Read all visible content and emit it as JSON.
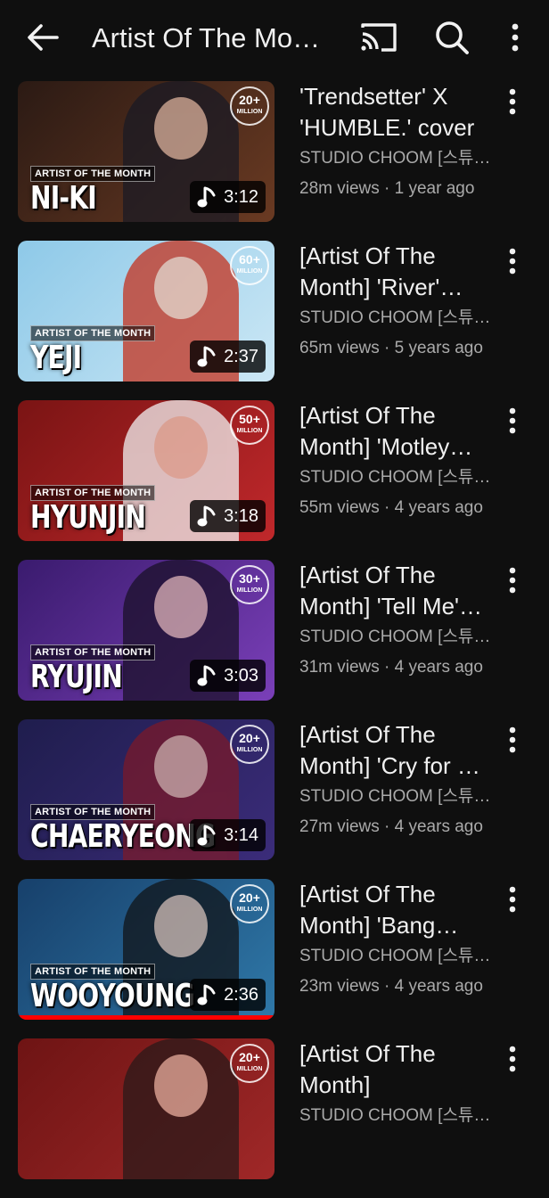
{
  "header": {
    "title": "Artist Of The Month",
    "icons": [
      "back-arrow-icon",
      "cast-icon",
      "search-icon",
      "more-vertical-icon"
    ]
  },
  "videos": [
    {
      "title": "'Trendsetter' X 'HUMBLE.' cover",
      "channel": "STUDIO CHOOM [스튜디오 춤]",
      "stats": "28m views · 1 year ago",
      "duration": "3:12",
      "thumb_artist": "NI-KI",
      "thumb_badge": "ARTIST OF THE MONTH",
      "award_num": "20+",
      "award_unit": "MILLION",
      "colors": {
        "bg1": "#2b1a14",
        "bg2": "#6a3a22",
        "figure": "#1a1a24"
      },
      "watched": 0
    },
    {
      "title": "[Artist Of The Month] 'River' cover",
      "channel": "STUDIO CHOOM [스튜디오 춤]",
      "stats": "65m views · 5 years ago",
      "duration": "2:37",
      "thumb_artist": "YEJI",
      "thumb_badge": "ARTIST OF THE MONTH",
      "award_num": "60+",
      "award_unit": "MILLION",
      "colors": {
        "bg1": "#8ec9e8",
        "bg2": "#cbe7f5",
        "figure": "#c4321e"
      },
      "watched": 0
    },
    {
      "title": "[Artist Of The Month] 'Motley Crew' cover",
      "channel": "STUDIO CHOOM [스튜디오 춤]",
      "stats": "55m views · 4 years ago",
      "duration": "3:18",
      "thumb_artist": "HYUNJIN",
      "thumb_badge": "ARTIST OF THE MONTH",
      "award_num": "50+",
      "award_unit": "MILLION",
      "colors": {
        "bg1": "#7a1414",
        "bg2": "#c0282b",
        "figure": "#f1f1f1"
      },
      "watched": 0
    },
    {
      "title": "[Artist Of The Month] 'Tell Me' cover",
      "channel": "STUDIO CHOOM [스튜디오 춤]",
      "stats": "31m views · 4 years ago",
      "duration": "3:03",
      "thumb_artist": "RYUJIN",
      "thumb_badge": "ARTIST OF THE MONTH",
      "award_num": "30+",
      "award_unit": "MILLION",
      "colors": {
        "bg1": "#3a1b6e",
        "bg2": "#7a3fb8",
        "figure": "#1a1028"
      },
      "watched": 0
    },
    {
      "title": "[Artist Of The Month] 'Cry for Me' cover",
      "channel": "STUDIO CHOOM [스튜디오 춤]",
      "stats": "27m views · 4 years ago",
      "duration": "3:14",
      "thumb_artist": "CHAERYEONG",
      "thumb_badge": "ARTIST OF THE MONTH",
      "award_num": "20+",
      "award_unit": "MILLION",
      "colors": {
        "bg1": "#1f1d4d",
        "bg2": "#3b2c7a",
        "figure": "#7a1a2a"
      },
      "watched": 0
    },
    {
      "title": "[Artist Of The Month] 'Bang Bang' cover",
      "channel": "STUDIO CHOOM [스튜디오 춤]",
      "stats": "23m views · 4 years ago",
      "duration": "2:36",
      "thumb_artist": "WOOYOUNG",
      "thumb_badge": "ARTIST OF THE MONTH",
      "award_num": "20+",
      "award_unit": "MILLION",
      "colors": {
        "bg1": "#17406b",
        "bg2": "#2f78a8",
        "figure": "#111418"
      },
      "watched": 1.0
    },
    {
      "title": "[Artist Of The Month]",
      "channel": "STUDIO CHOOM [스튜디오 춤]",
      "stats": "",
      "duration": "",
      "thumb_artist": "",
      "thumb_badge": "",
      "award_num": "20+",
      "award_unit": "MILLION",
      "colors": {
        "bg1": "#6e1414",
        "bg2": "#a02828",
        "figure": "#2a1a1a"
      },
      "watched": 0
    }
  ]
}
